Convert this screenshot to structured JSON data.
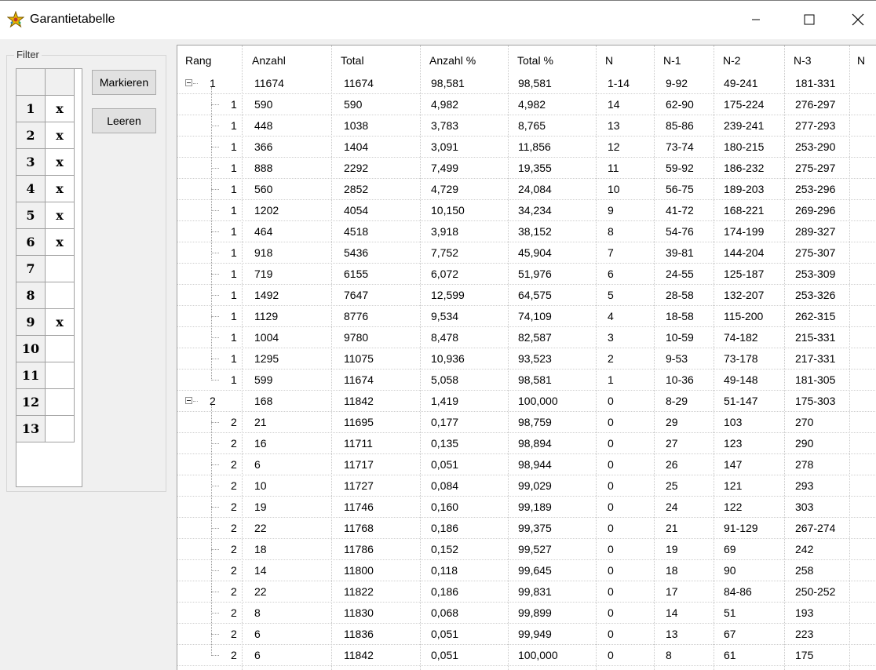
{
  "window": {
    "title": "Garantietabelle"
  },
  "filter": {
    "legend": "Filter",
    "rows": [
      {
        "num": "1",
        "val": "x"
      },
      {
        "num": "2",
        "val": "x"
      },
      {
        "num": "3",
        "val": "x"
      },
      {
        "num": "4",
        "val": "x"
      },
      {
        "num": "5",
        "val": "x"
      },
      {
        "num": "6",
        "val": "x"
      },
      {
        "num": "7",
        "val": ""
      },
      {
        "num": "8",
        "val": ""
      },
      {
        "num": "9",
        "val": "x"
      },
      {
        "num": "10",
        "val": ""
      },
      {
        "num": "11",
        "val": ""
      },
      {
        "num": "12",
        "val": ""
      },
      {
        "num": "13",
        "val": ""
      }
    ],
    "buttons": {
      "mark": "Markieren",
      "clear": "Leeren"
    }
  },
  "table": {
    "columns": [
      "Rang",
      "Anzahl",
      "Total",
      "Anzahl %",
      "Total %",
      "N",
      "N-1",
      "N-2",
      "N-3",
      "N"
    ],
    "rows": [
      {
        "level": 0,
        "cells": [
          "1",
          "11674",
          "11674",
          "98,581",
          "98,581",
          "1-14",
          "9-92",
          "49-241",
          "181-331"
        ]
      },
      {
        "level": 1,
        "cells": [
          "1",
          "590",
          "590",
          "4,982",
          "4,982",
          "14",
          "62-90",
          "175-224",
          "276-297"
        ]
      },
      {
        "level": 1,
        "cells": [
          "1",
          "448",
          "1038",
          "3,783",
          "8,765",
          "13",
          "85-86",
          "239-241",
          "277-293"
        ]
      },
      {
        "level": 1,
        "cells": [
          "1",
          "366",
          "1404",
          "3,091",
          "11,856",
          "12",
          "73-74",
          "180-215",
          "253-290"
        ]
      },
      {
        "level": 1,
        "cells": [
          "1",
          "888",
          "2292",
          "7,499",
          "19,355",
          "11",
          "59-92",
          "186-232",
          "275-297"
        ]
      },
      {
        "level": 1,
        "cells": [
          "1",
          "560",
          "2852",
          "4,729",
          "24,084",
          "10",
          "56-75",
          "189-203",
          "253-296"
        ]
      },
      {
        "level": 1,
        "cells": [
          "1",
          "1202",
          "4054",
          "10,150",
          "34,234",
          "9",
          "41-72",
          "168-221",
          "269-296"
        ]
      },
      {
        "level": 1,
        "cells": [
          "1",
          "464",
          "4518",
          "3,918",
          "38,152",
          "8",
          "54-76",
          "174-199",
          "289-327"
        ]
      },
      {
        "level": 1,
        "cells": [
          "1",
          "918",
          "5436",
          "7,752",
          "45,904",
          "7",
          "39-81",
          "144-204",
          "275-307"
        ]
      },
      {
        "level": 1,
        "cells": [
          "1",
          "719",
          "6155",
          "6,072",
          "51,976",
          "6",
          "24-55",
          "125-187",
          "253-309"
        ]
      },
      {
        "level": 1,
        "cells": [
          "1",
          "1492",
          "7647",
          "12,599",
          "64,575",
          "5",
          "28-58",
          "132-207",
          "253-326"
        ]
      },
      {
        "level": 1,
        "cells": [
          "1",
          "1129",
          "8776",
          "9,534",
          "74,109",
          "4",
          "18-58",
          "115-200",
          "262-315"
        ]
      },
      {
        "level": 1,
        "cells": [
          "1",
          "1004",
          "9780",
          "8,478",
          "82,587",
          "3",
          "10-59",
          "74-182",
          "215-331"
        ]
      },
      {
        "level": 1,
        "cells": [
          "1",
          "1295",
          "11075",
          "10,936",
          "93,523",
          "2",
          "9-53",
          "73-178",
          "217-331"
        ]
      },
      {
        "level": 1,
        "cells": [
          "1",
          "599",
          "11674",
          "5,058",
          "98,581",
          "1",
          "10-36",
          "49-148",
          "181-305"
        ]
      },
      {
        "level": 0,
        "cells": [
          "2",
          "168",
          "11842",
          "1,419",
          "100,000",
          "0",
          "8-29",
          "51-147",
          "175-303"
        ]
      },
      {
        "level": 1,
        "cells": [
          "2",
          "21",
          "11695",
          "0,177",
          "98,759",
          "0",
          "29",
          "103",
          "270"
        ]
      },
      {
        "level": 1,
        "cells": [
          "2",
          "16",
          "11711",
          "0,135",
          "98,894",
          "0",
          "27",
          "123",
          "290"
        ]
      },
      {
        "level": 1,
        "cells": [
          "2",
          "6",
          "11717",
          "0,051",
          "98,944",
          "0",
          "26",
          "147",
          "278"
        ]
      },
      {
        "level": 1,
        "cells": [
          "2",
          "10",
          "11727",
          "0,084",
          "99,029",
          "0",
          "25",
          "121",
          "293"
        ]
      },
      {
        "level": 1,
        "cells": [
          "2",
          "19",
          "11746",
          "0,160",
          "99,189",
          "0",
          "24",
          "122",
          "303"
        ]
      },
      {
        "level": 1,
        "cells": [
          "2",
          "22",
          "11768",
          "0,186",
          "99,375",
          "0",
          "21",
          "91-129",
          "267-274"
        ]
      },
      {
        "level": 1,
        "cells": [
          "2",
          "18",
          "11786",
          "0,152",
          "99,527",
          "0",
          "19",
          "69",
          "242"
        ]
      },
      {
        "level": 1,
        "cells": [
          "2",
          "14",
          "11800",
          "0,118",
          "99,645",
          "0",
          "18",
          "90",
          "258"
        ]
      },
      {
        "level": 1,
        "cells": [
          "2",
          "22",
          "11822",
          "0,186",
          "99,831",
          "0",
          "17",
          "84-86",
          "250-252"
        ]
      },
      {
        "level": 1,
        "cells": [
          "2",
          "8",
          "11830",
          "0,068",
          "99,899",
          "0",
          "14",
          "51",
          "193"
        ]
      },
      {
        "level": 1,
        "cells": [
          "2",
          "6",
          "11836",
          "0,051",
          "99,949",
          "0",
          "13",
          "67",
          "223"
        ]
      },
      {
        "level": 1,
        "cells": [
          "2",
          "6",
          "11842",
          "0,051",
          "100,000",
          "0",
          "8",
          "61",
          "175"
        ]
      }
    ]
  }
}
